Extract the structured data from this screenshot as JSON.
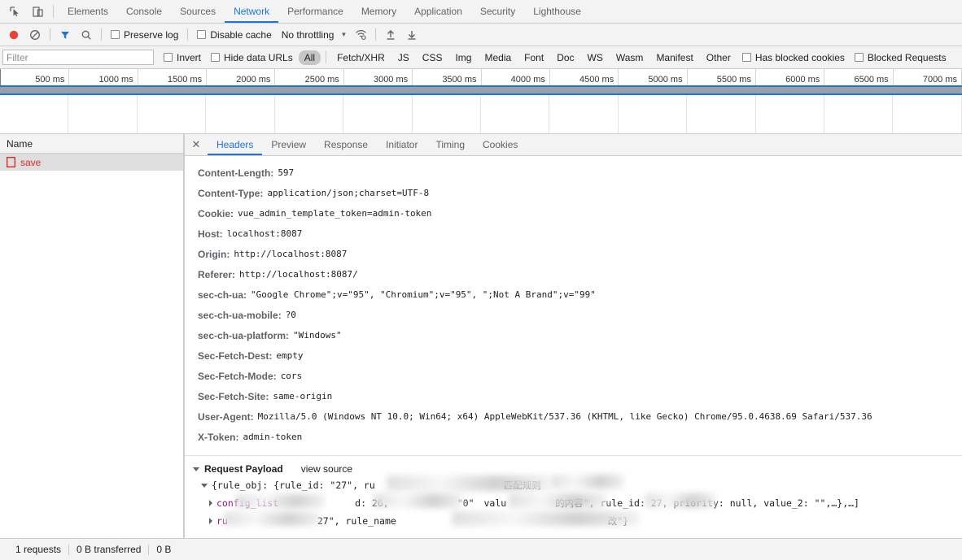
{
  "tabstrip": {
    "icons": [
      {
        "name": "inspect-element-icon"
      },
      {
        "name": "device-toolbar-icon"
      }
    ],
    "tabs": [
      {
        "label": "Elements",
        "active": false
      },
      {
        "label": "Console",
        "active": false
      },
      {
        "label": "Sources",
        "active": false
      },
      {
        "label": "Network",
        "active": true
      },
      {
        "label": "Performance",
        "active": false
      },
      {
        "label": "Memory",
        "active": false
      },
      {
        "label": "Application",
        "active": false
      },
      {
        "label": "Security",
        "active": false
      },
      {
        "label": "Lighthouse",
        "active": false
      }
    ]
  },
  "toolbar": {
    "record_icon": "record-button-icon",
    "clear_icon": "clear-icon",
    "filter_icon": "filter-funnel-icon",
    "search_icon": "search-icon",
    "preserve_log_label": "Preserve log",
    "disable_cache_label": "Disable cache",
    "throttling_value": "No throttling",
    "wifi_icon": "network-conditions-icon",
    "import_icon": "import-har-icon",
    "export_icon": "export-har-icon"
  },
  "filterbar": {
    "placeholder": "Filter",
    "value": "",
    "invert_label": "Invert",
    "hide_data_urls_label": "Hide data URLs",
    "types": [
      {
        "label": "All",
        "active": true
      },
      {
        "label": "Fetch/XHR",
        "active": false
      },
      {
        "label": "JS",
        "active": false
      },
      {
        "label": "CSS",
        "active": false
      },
      {
        "label": "Img",
        "active": false
      },
      {
        "label": "Media",
        "active": false
      },
      {
        "label": "Font",
        "active": false
      },
      {
        "label": "Doc",
        "active": false
      },
      {
        "label": "WS",
        "active": false
      },
      {
        "label": "Wasm",
        "active": false
      },
      {
        "label": "Manifest",
        "active": false
      },
      {
        "label": "Other",
        "active": false
      }
    ],
    "has_blocked_cookies_label": "Has blocked cookies",
    "blocked_requests_label": "Blocked Requests"
  },
  "timeline": {
    "ticks": [
      "500 ms",
      "1000 ms",
      "1500 ms",
      "2000 ms",
      "2500 ms",
      "3000 ms",
      "3500 ms",
      "4000 ms",
      "4500 ms",
      "5000 ms",
      "5500 ms",
      "6000 ms",
      "6500 ms",
      "7000 ms"
    ]
  },
  "request_list": {
    "column_header": "Name",
    "rows": [
      {
        "name": "save",
        "status_icon": "document-error-icon"
      }
    ]
  },
  "detail": {
    "close_icon": "close-icon",
    "tabs": [
      {
        "label": "Headers",
        "active": true
      },
      {
        "label": "Preview",
        "active": false
      },
      {
        "label": "Response",
        "active": false
      },
      {
        "label": "Initiator",
        "active": false
      },
      {
        "label": "Timing",
        "active": false
      },
      {
        "label": "Cookies",
        "active": false
      }
    ],
    "headers": [
      {
        "name": "Content-Length:",
        "value": "597"
      },
      {
        "name": "Content-Type:",
        "value": "application/json;charset=UTF-8"
      },
      {
        "name": "Cookie:",
        "value": "vue_admin_template_token=admin-token"
      },
      {
        "name": "Host:",
        "value": "localhost:8087"
      },
      {
        "name": "Origin:",
        "value": "http://localhost:8087"
      },
      {
        "name": "Referer:",
        "value": "http://localhost:8087/"
      },
      {
        "name": "sec-ch-ua:",
        "value": "\"Google Chrome\";v=\"95\", \"Chromium\";v=\"95\", \";Not A Brand\";v=\"99\""
      },
      {
        "name": "sec-ch-ua-mobile:",
        "value": "?0"
      },
      {
        "name": "sec-ch-ua-platform:",
        "value": "\"Windows\""
      },
      {
        "name": "Sec-Fetch-Dest:",
        "value": "empty"
      },
      {
        "name": "Sec-Fetch-Mode:",
        "value": "cors"
      },
      {
        "name": "Sec-Fetch-Site:",
        "value": "same-origin"
      },
      {
        "name": "User-Agent:",
        "value": "Mozilla/5.0 (Windows NT 10.0; Win64; x64) AppleWebKit/537.36 (KHTML, like Gecko) Chrome/95.0.4638.69 Safari/537.36"
      },
      {
        "name": "X-Token:",
        "value": "admin-token"
      }
    ],
    "payload": {
      "title": "Request Payload",
      "view_source_label": "view source",
      "line_1_prefix": "{rule_obj: {rule_id: \"27\", ru",
      "line_1_mid": "匹配规则",
      "line_2_key": "config_list",
      "line_2_mid": "d: 26,",
      "line_2_quote": "\"0\"",
      "line_2_val": "valu",
      "line_2_tail": "的内容\", rule_id: 27, priority: null, value_2: \"\",…},…]",
      "line_3_key": "ru",
      "line_3_mid": "27\", rule_name",
      "line_3_tail": "改\"}"
    }
  },
  "statusbar": {
    "requests": "1 requests",
    "transferred": "0 B transferred",
    "resources": "0 B"
  }
}
